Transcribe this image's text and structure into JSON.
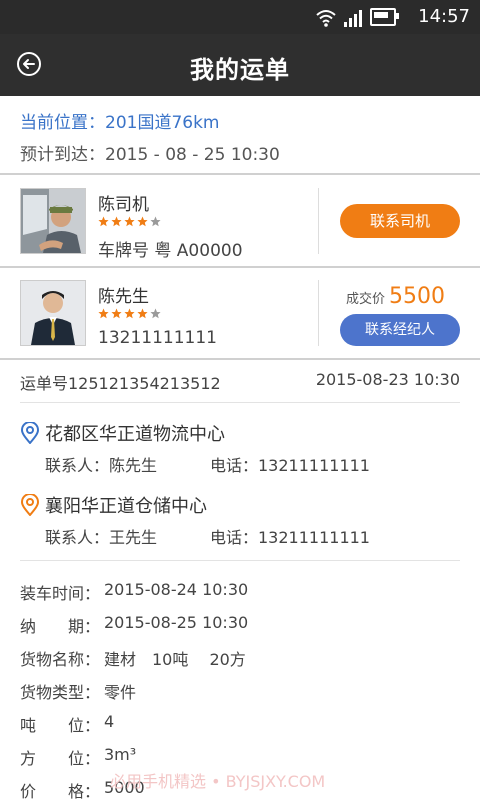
{
  "status_bar": {
    "time": "14:57",
    "icons": [
      "wifi-icon",
      "signal-icon",
      "battery-icon"
    ]
  },
  "header": {
    "title": "我的运单",
    "back_icon": "back-arrow-icon"
  },
  "location": {
    "current": "当前位置：201国道76km",
    "eta": "预计到达：2015 - 08 - 25  10:30"
  },
  "driver": {
    "name": "陈司机",
    "rating": 4,
    "plate": "车牌号  粤 A00000",
    "contact_label": "联系司机"
  },
  "broker": {
    "name": "陈先生",
    "rating": 4,
    "phone": "13211111111",
    "price_label": "成交价",
    "price_value": "5500",
    "contact_label": "联系经纪人"
  },
  "order": {
    "number": "运单号125121354213512",
    "date": "2015-08-23 10:30"
  },
  "origin": {
    "name": "花都区华正道物流中心",
    "contact": "联系人：陈先生",
    "phone": "电话：13211111111"
  },
  "destination": {
    "name": "襄阳华正道仓储中心",
    "contact": "联系人：王先生",
    "phone": "电话：13211111111"
  },
  "details": [
    {
      "label": "装车时间：",
      "value": "2015-08-24 10:30"
    },
    {
      "label": "纳　　期：",
      "value": "2015-08-25 10:30"
    },
    {
      "label": "货物名称：",
      "value": "建材　10吨　 20方"
    },
    {
      "label": "货物类型：",
      "value": "零件"
    },
    {
      "label": "吨　　位：",
      "value": "4"
    },
    {
      "label": "方　　位：",
      "value": "3m³"
    },
    {
      "label": "价　　格：",
      "value": "5000"
    }
  ],
  "watermark": "必用手机精选 • BYJSJXY.COM",
  "colors": {
    "accent_orange": "#f07d14",
    "accent_blue": "#4d74cc",
    "link_blue": "#3a73c8"
  }
}
